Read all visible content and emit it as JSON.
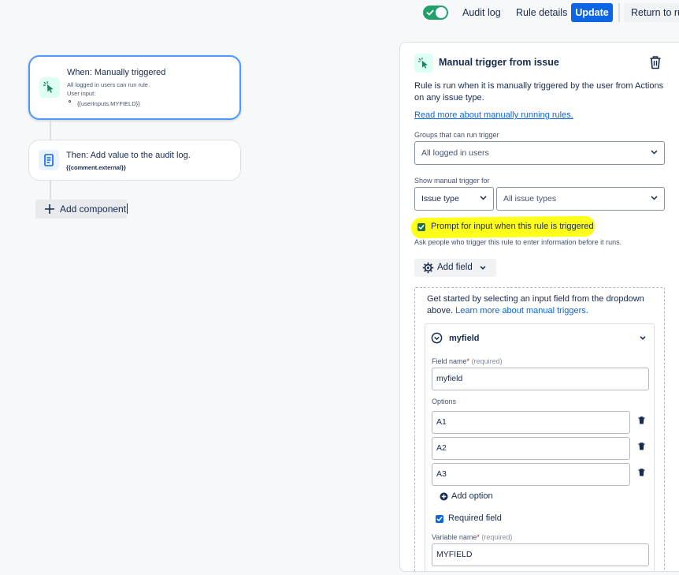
{
  "top_bar": {
    "rule_enabled": true,
    "audit_log": "Audit log",
    "rule_details": "Rule details",
    "update": "Update",
    "return": "Return to rules"
  },
  "flow": {
    "trigger": {
      "title": "When: Manually triggered",
      "line1": "All logged in users can run rule.",
      "line2": "User input:",
      "line3": "{{userInputs.MYFIELD}}",
      "icon": "cursor-click-icon"
    },
    "action": {
      "title": "Then: Add value to the audit log.",
      "subtitle": "{{comment.external}}",
      "icon": "document-icon"
    },
    "add_component": "Add component"
  },
  "panel": {
    "title": "Manual trigger from issue",
    "description": "Rule is run when it is manually triggered by the user from Actions on any issue type.",
    "read_more": "Read more about manually running rules.",
    "groups_label": "Groups that can run trigger",
    "groups_value": "All logged in users",
    "show_for_label": "Show manual trigger for",
    "show_for_type": "Issue type",
    "show_for_value": "All issue types",
    "prompt_checked": true,
    "prompt_label": "Prompt for input when this rule is triggered",
    "prompt_helper": "Ask people who trigger this rule to enter information before it runs.",
    "add_field": "Add field",
    "get_started": "Get started by selecting an input field from the dropdown above.",
    "learn_more": "Learn more about manual triggers.",
    "highlight_color": "#ffff1a",
    "field": {
      "name": "myfield",
      "field_name_label": "Field name",
      "required_star": "*",
      "required_hint": "(required)",
      "field_name_value": "myfield",
      "options_label": "Options",
      "options": [
        "A1",
        "A2",
        "A3"
      ],
      "add_option": "Add option",
      "required_checked": true,
      "required_label": "Required field",
      "variable_name_label": "Variable name",
      "variable_name_value": "MYFIELD"
    }
  }
}
